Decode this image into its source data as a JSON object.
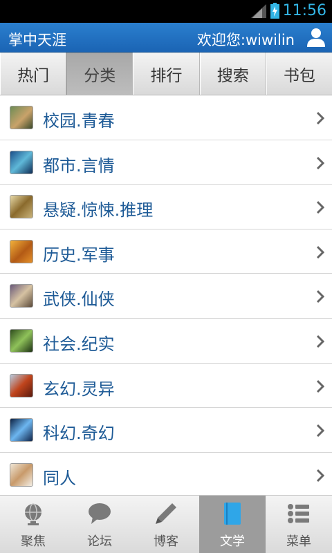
{
  "status_bar": {
    "time": "11:56"
  },
  "header": {
    "app_title": "掌中天涯",
    "welcome": "欢迎您:wiwilin"
  },
  "tabs": [
    {
      "label": "热门",
      "active": false
    },
    {
      "label": "分类",
      "active": true
    },
    {
      "label": "排行",
      "active": false
    },
    {
      "label": "搜索",
      "active": false
    },
    {
      "label": "书包",
      "active": false
    }
  ],
  "categories": [
    {
      "label": "校园.青春"
    },
    {
      "label": "都市.言情"
    },
    {
      "label": "悬疑.惊悚.推理"
    },
    {
      "label": "历史.军事"
    },
    {
      "label": "武侠.仙侠"
    },
    {
      "label": "社会.纪实"
    },
    {
      "label": "玄幻.灵异"
    },
    {
      "label": "科幻.奇幻"
    },
    {
      "label": "同人"
    }
  ],
  "bottom_nav": [
    {
      "label": "聚焦",
      "icon": "globe-icon",
      "active": false
    },
    {
      "label": "论坛",
      "icon": "chat-bubble-icon",
      "active": false
    },
    {
      "label": "博客",
      "icon": "pen-icon",
      "active": false
    },
    {
      "label": "文学",
      "icon": "book-icon",
      "active": true
    },
    {
      "label": "菜单",
      "icon": "list-menu-icon",
      "active": false
    }
  ],
  "colors": {
    "title_bar": "#1f6cbe",
    "link_text": "#1d5a96",
    "status_time": "#33b5e5"
  }
}
